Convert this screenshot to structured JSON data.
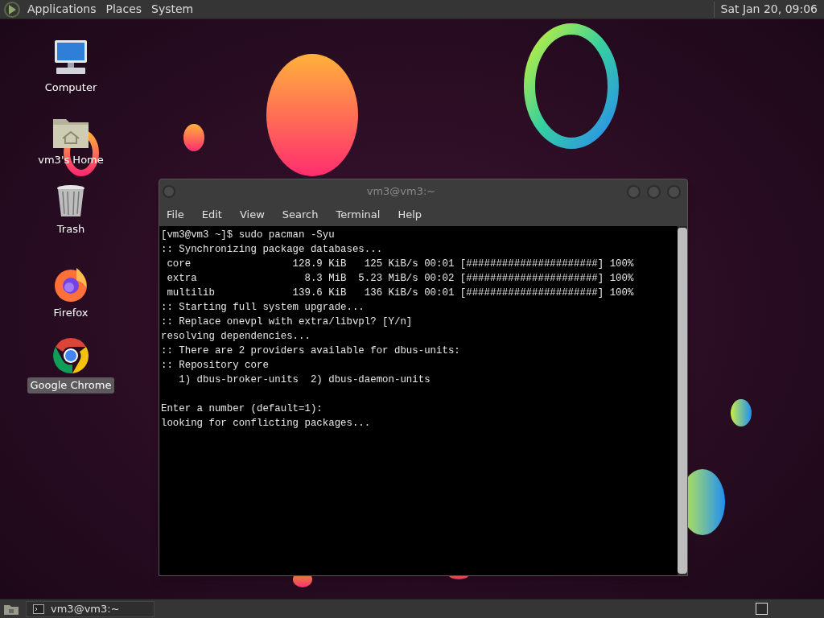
{
  "top_panel": {
    "menus": [
      "Applications",
      "Places",
      "System"
    ],
    "clock": "Sat Jan 20, 09:06"
  },
  "desktop_icons": [
    {
      "kind": "computer",
      "label": "Computer",
      "selected": false
    },
    {
      "kind": "home",
      "label": "vm3's Home",
      "selected": false
    },
    {
      "kind": "trash",
      "label": "Trash",
      "selected": false
    },
    {
      "kind": "firefox",
      "label": "Firefox",
      "selected": false
    },
    {
      "kind": "chrome",
      "label": "Google Chrome",
      "selected": true
    }
  ],
  "terminal": {
    "title": "vm3@vm3:~",
    "menu": [
      "File",
      "Edit",
      "View",
      "Search",
      "Terminal",
      "Help"
    ],
    "blocks": [
      [
        "[vm3@vm3 ~]$ sudo pacman -Syu",
        ":: Synchronizing package databases...",
        " core                 128.9 KiB   125 KiB/s 00:01 [######################] 100%",
        " extra                  8.3 MiB  5.23 MiB/s 00:02 [######################] 100%",
        " multilib             139.6 KiB   136 KiB/s 00:01 [######################] 100%",
        ":: Starting full system upgrade...",
        ":: Replace onevpl with extra/libvpl? [Y/n]",
        "resolving dependencies...",
        ":: There are 2 providers available for dbus-units:",
        ":: Repository core",
        "   1) dbus-broker-units  2) dbus-daemon-units"
      ],
      [
        "Enter a number (default=1):",
        "looking for conflicting packages..."
      ]
    ]
  },
  "taskbar": {
    "tasks": [
      {
        "label": "vm3@vm3:~",
        "selected": false
      }
    ]
  }
}
